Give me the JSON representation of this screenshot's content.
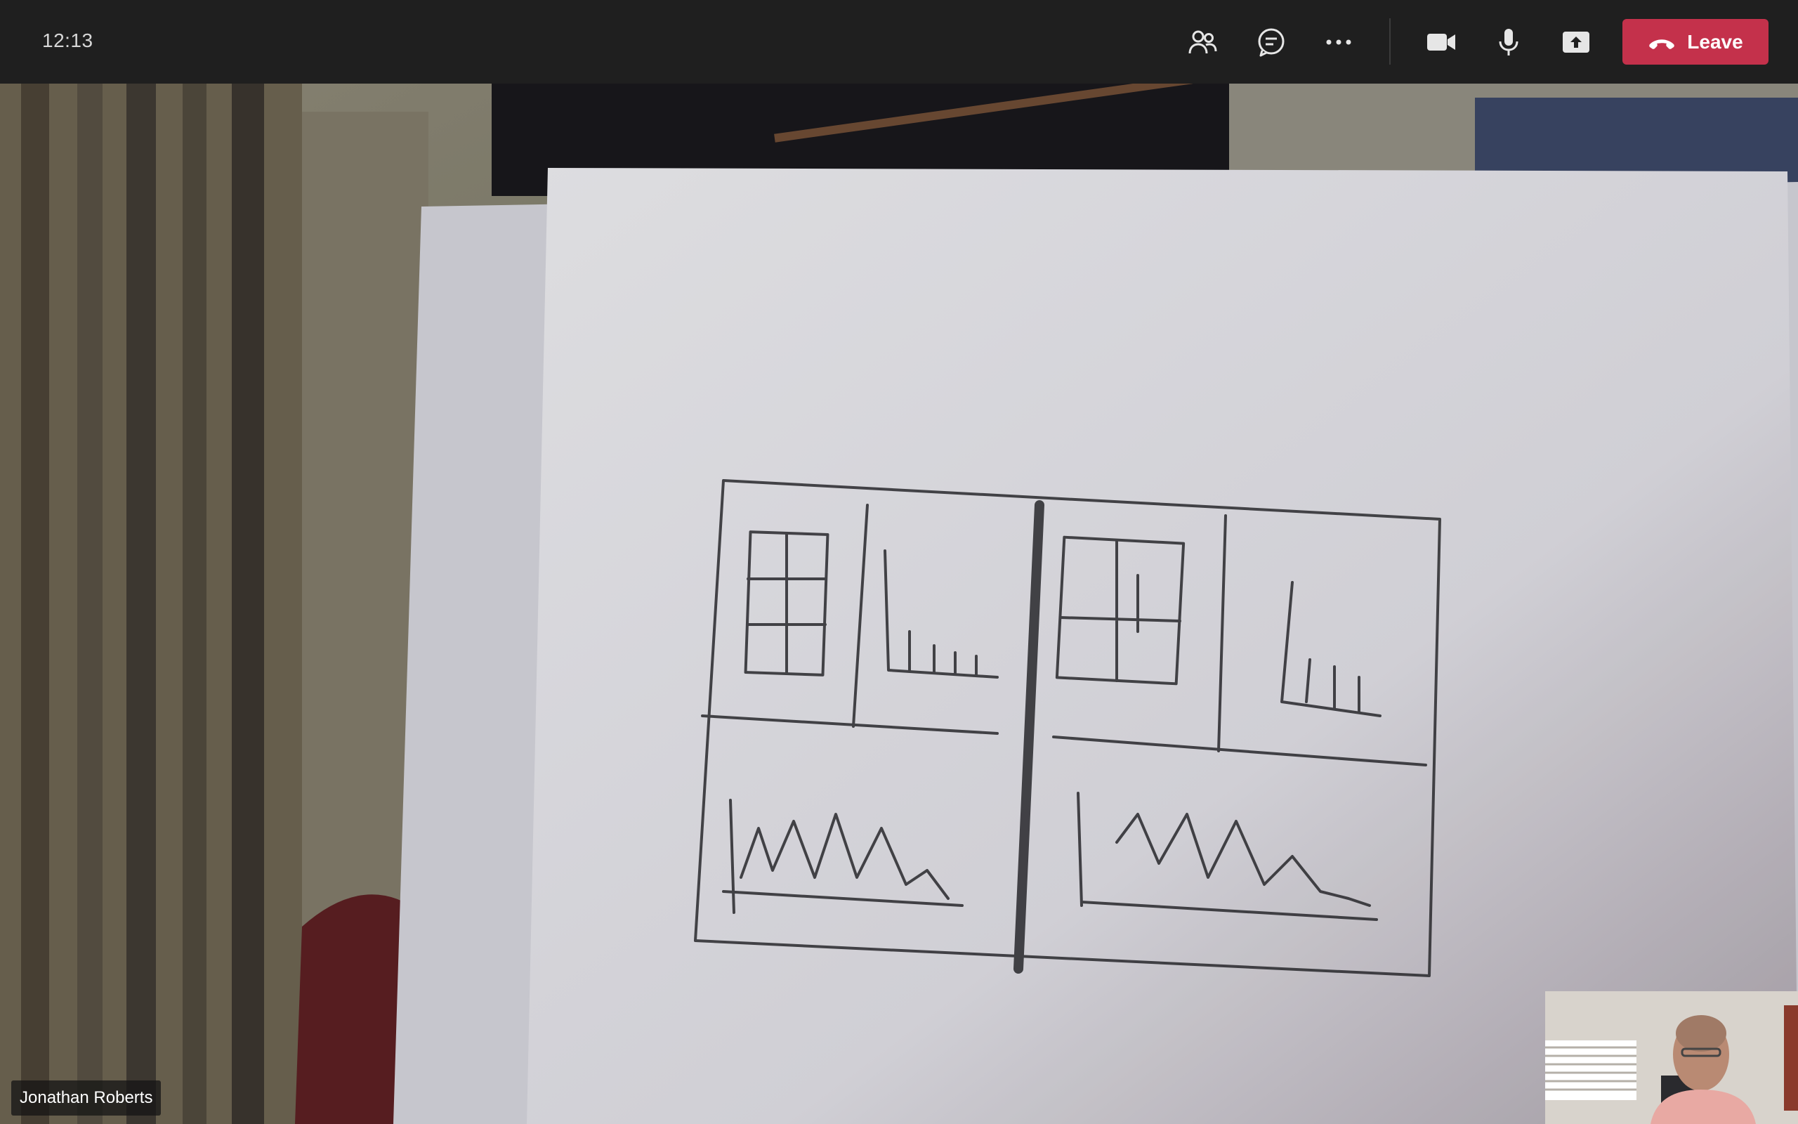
{
  "meeting": {
    "time": "12:13"
  },
  "toolbar": {
    "participants_icon": "people-icon",
    "chat_icon": "chat-icon",
    "more_icon": "more-icon",
    "camera_icon": "camera-icon",
    "mic_icon": "microphone-icon",
    "share_icon": "share-screen-icon",
    "leave_label": "Leave",
    "leave_color": "#c4314b"
  },
  "video": {
    "participant_name": "Jonathan Roberts"
  }
}
